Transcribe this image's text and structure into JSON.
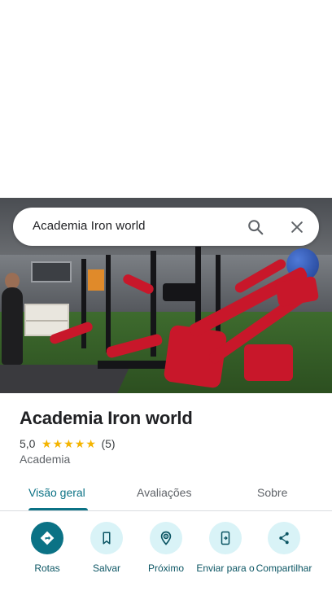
{
  "search": {
    "query": "Academia Iron world"
  },
  "place": {
    "name": "Academia Iron world",
    "rating": "5,0",
    "stars": 5,
    "review_count": "(5)",
    "category": "Academia"
  },
  "tabs": [
    {
      "label": "Visão geral",
      "active": true
    },
    {
      "label": "Avaliações",
      "active": false
    },
    {
      "label": "Sobre",
      "active": false
    }
  ],
  "actions": [
    {
      "label": "Rotas",
      "icon": "directions-icon"
    },
    {
      "label": "Salvar",
      "icon": "bookmark-icon"
    },
    {
      "label": "Próximo",
      "icon": "nearby-icon"
    },
    {
      "label": "Enviar para o",
      "icon": "send-to-phone-icon"
    },
    {
      "label": "Compartilhar",
      "icon": "share-icon"
    }
  ],
  "colors": {
    "accent": "#0b7285",
    "action_bg": "#d9f3f7",
    "star": "#f4b400"
  }
}
